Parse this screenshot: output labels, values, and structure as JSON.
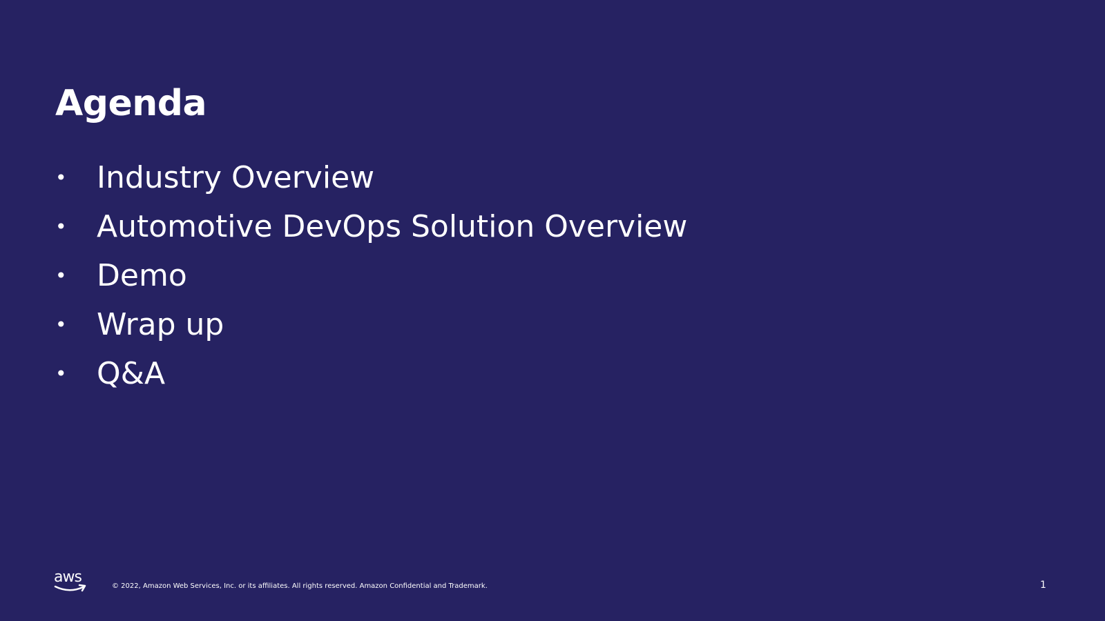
{
  "slide": {
    "title": "Agenda",
    "bullet_glyph": "•",
    "agenda_items": [
      {
        "label": "Industry Overview"
      },
      {
        "label": "Automotive DevOps Solution Overview"
      },
      {
        "label": "Demo"
      },
      {
        "label": "Wrap up"
      },
      {
        "label": "Q&A"
      }
    ],
    "footer": {
      "logo_text": "aws",
      "copyright": "© 2022, Amazon Web Services, Inc. or its affiliates. All rights reserved. Amazon Confidential and Trademark.",
      "page_number": "1"
    },
    "colors": {
      "background": "#262262",
      "text": "#ffffff"
    }
  }
}
